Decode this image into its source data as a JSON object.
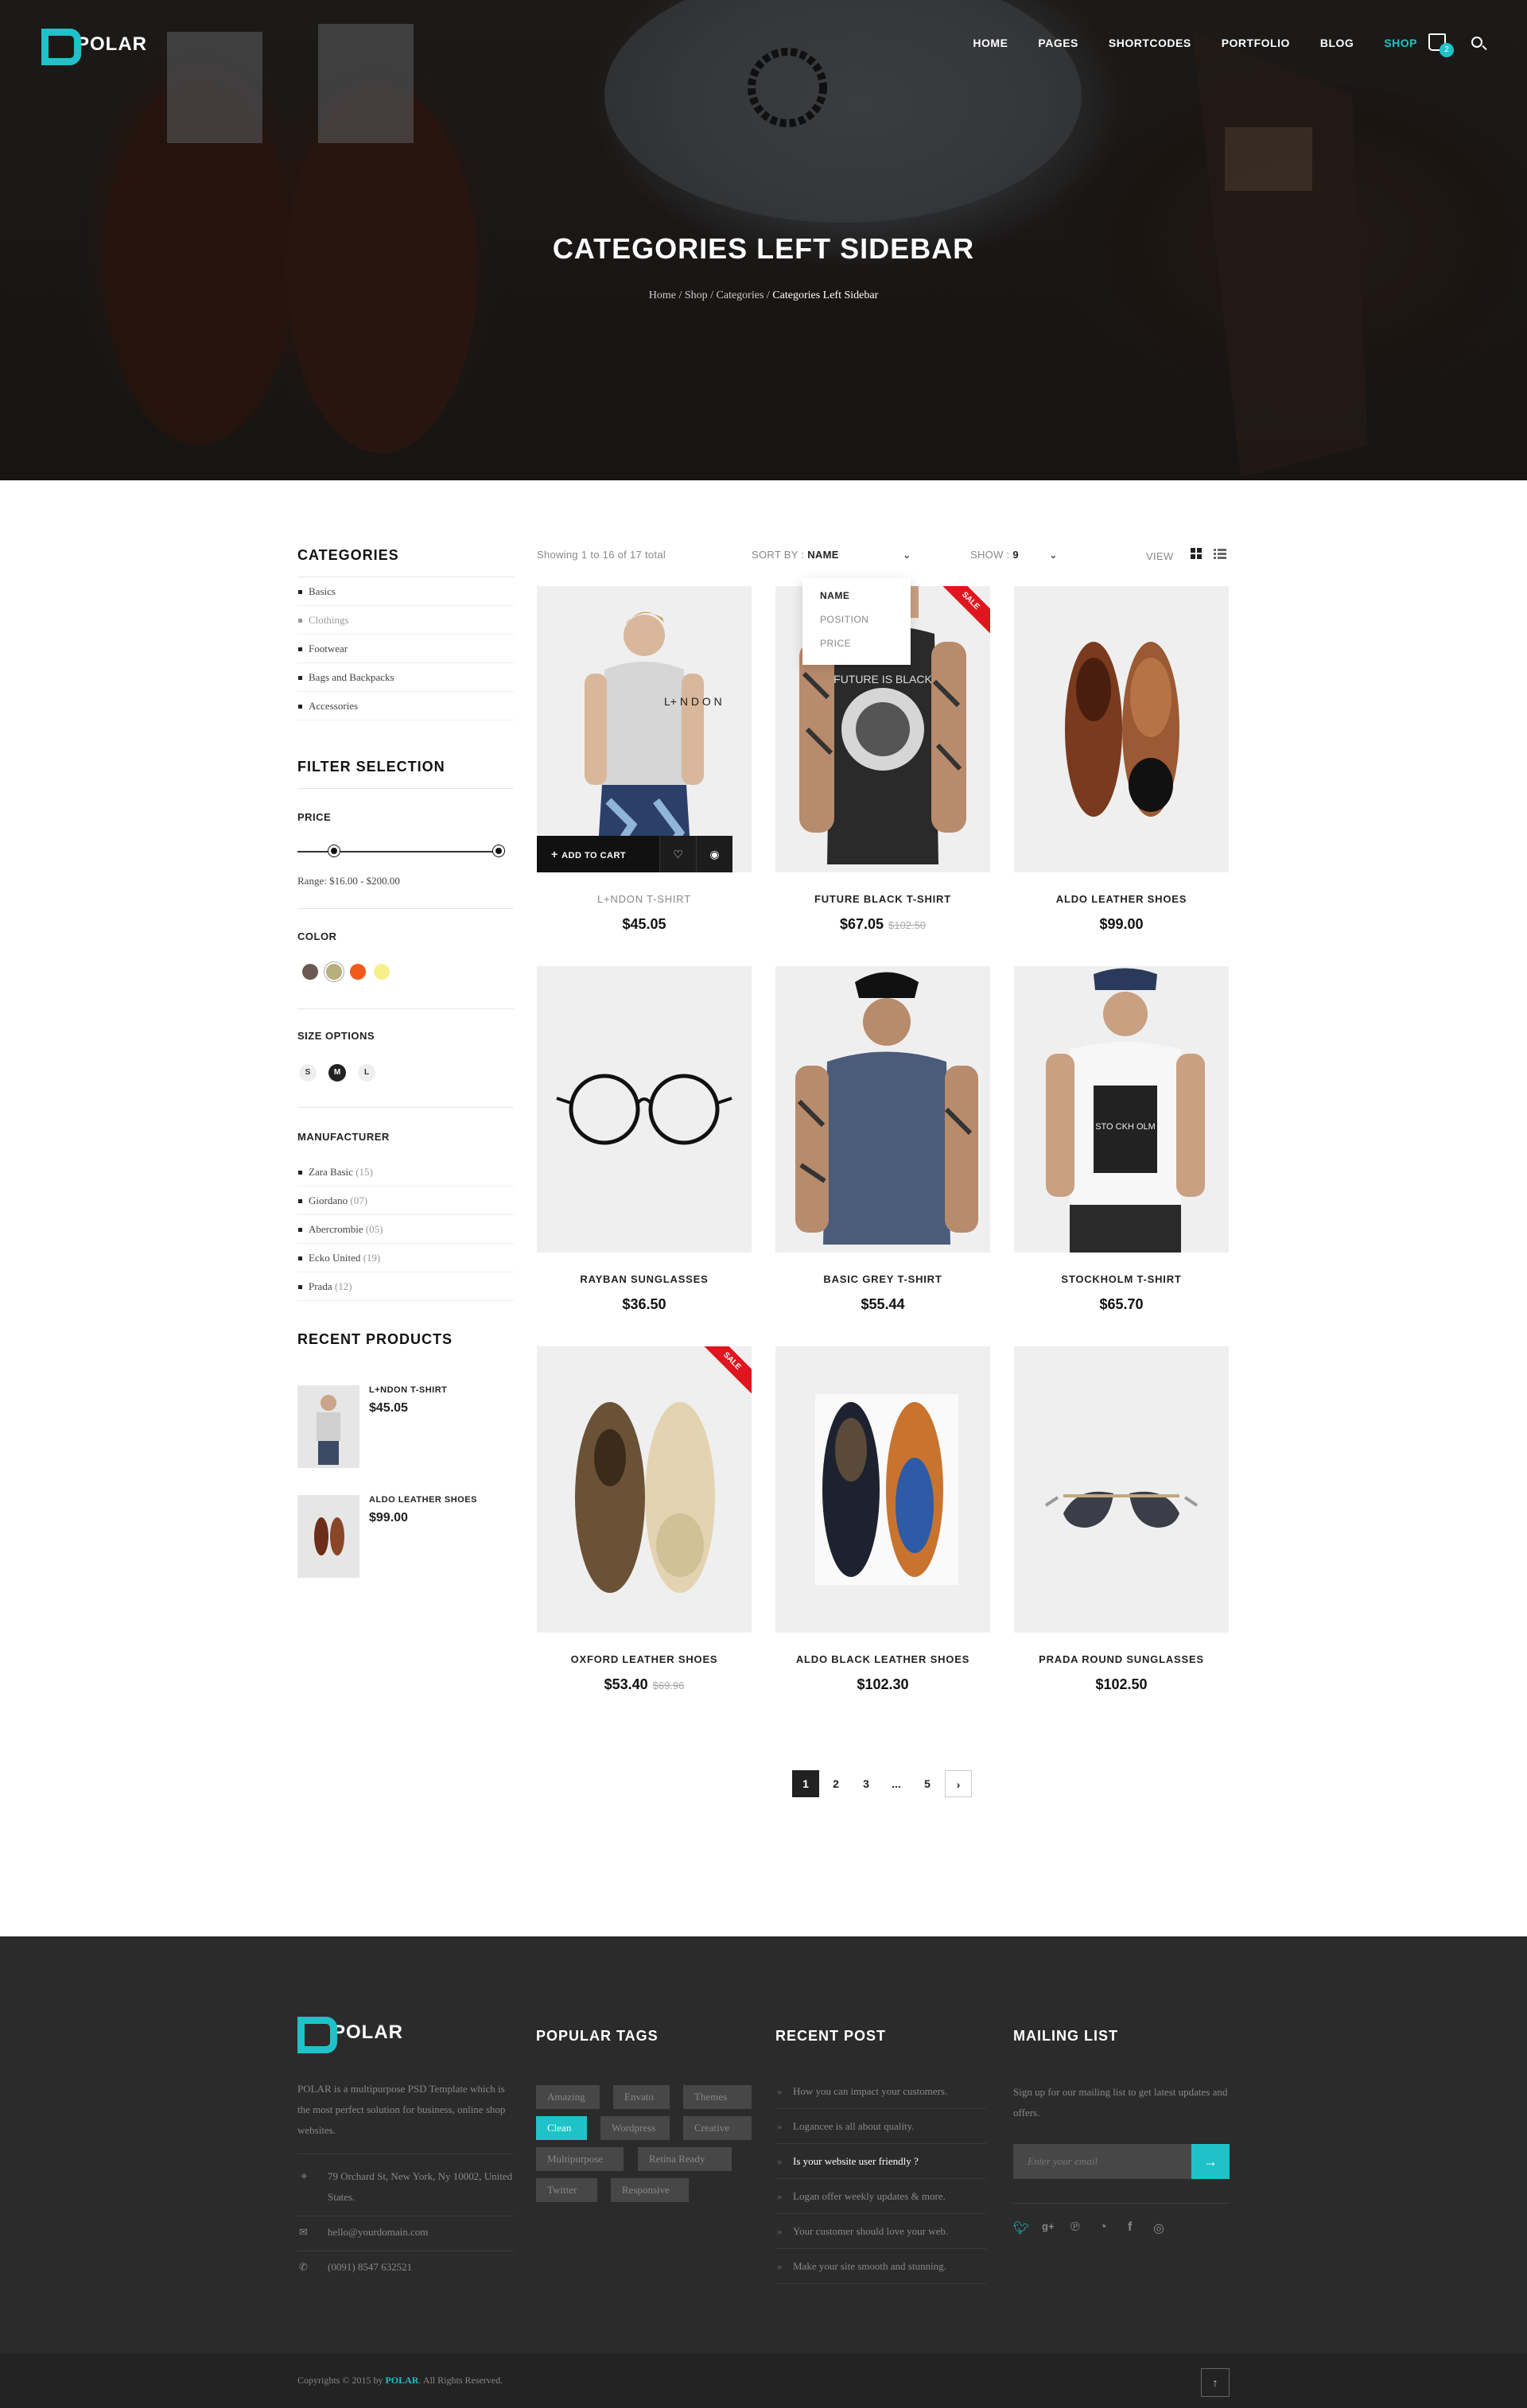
{
  "brand": {
    "name": "POLAR",
    "accent": "#1fc2c8"
  },
  "nav": {
    "items": [
      "HOME",
      "PAGES",
      "SHORTCODES",
      "PORTFOLIO",
      "BLOG",
      "SHOP"
    ],
    "active": "SHOP",
    "cart_count": "2"
  },
  "hero": {
    "title": "CATEGORIES LEFT SIDEBAR",
    "crumbs": [
      "Home",
      "Shop",
      "Categories",
      "Categories Left Sidebar"
    ],
    "sep": " / "
  },
  "sidebar": {
    "categories_title": "CATEGORIES",
    "categories": [
      "Basics",
      "Clothings",
      "Footwear",
      "Bags and Backpacks",
      "Accessories"
    ],
    "filter_title": "FILTER SELECTION",
    "price_label": "PRICE",
    "range_text": "Range: $16.00  -  $200.00",
    "color_label": "COLOR",
    "colors": [
      "#6b5a52",
      "#b5b07a",
      "#f05a1a",
      "#f6f08a"
    ],
    "size_label": "SIZE OPTIONS",
    "sizes": [
      "S",
      "M",
      "L"
    ],
    "size_selected": "M",
    "manufacturer_label": "MANUFACTURER",
    "manufacturers": [
      {
        "name": "Zara Basic",
        "count": "(15)"
      },
      {
        "name": "Giordano",
        "count": "(07)"
      },
      {
        "name": "Abercrombie",
        "count": "(05)"
      },
      {
        "name": "Ecko United",
        "count": "(19)"
      },
      {
        "name": "Prada",
        "count": "(12)"
      }
    ],
    "recent_title": "RECENT PRODUCTS",
    "recent": [
      {
        "name": "L+NDON T-SHIRT",
        "price": "$45.05"
      },
      {
        "name": "ALDO LEATHER SHOES",
        "price": "$99.00"
      }
    ]
  },
  "toolbar": {
    "showing": "Showing 1 to 16 of 17 total",
    "sort_label": "SORT BY :",
    "sort_value": "NAME",
    "sort_options": [
      "NAME",
      "POSITION",
      "PRICE"
    ],
    "show_label": "SHOW :",
    "show_value": "9",
    "view_label": "VIEW"
  },
  "products": [
    {
      "name": "L+NDON T-SHIRT",
      "price": "$45.05",
      "old": "",
      "sale": false
    },
    {
      "name": "FUTURE BLACK T-SHIRT",
      "price": "$67.05",
      "old": "$102.50",
      "sale": true
    },
    {
      "name": "ALDO LEATHER SHOES",
      "price": "$99.00",
      "old": "",
      "sale": false
    },
    {
      "name": "RAYBAN SUNGLASSES",
      "price": "$36.50",
      "old": "",
      "sale": false
    },
    {
      "name": "BASIC GREY T-SHIRT",
      "price": "$55.44",
      "old": "",
      "sale": false
    },
    {
      "name": "STOCKHOLM T-SHIRT",
      "price": "$65.70",
      "old": "",
      "sale": false
    },
    {
      "name": "OXFORD LEATHER SHOES",
      "price": "$53.40",
      "old": "$69.96",
      "sale": true
    },
    {
      "name": "ALDO BLACK LEATHER SHOES",
      "price": "$102.30",
      "old": "",
      "sale": false
    },
    {
      "name": "PRADA ROUND SUNGLASSES",
      "price": "$102.50",
      "old": "",
      "sale": false
    }
  ],
  "product_overlay": {
    "add": "ADD TO CART"
  },
  "sale_label": "SALE",
  "shirt_prints": {
    "london": "L+ N D O N",
    "future": "FUTURE IS BLACK",
    "stockholm": "STO CKH OLM"
  },
  "pagination": [
    "1",
    "2",
    "3",
    "...",
    "5"
  ],
  "footer": {
    "about": "POLAR is a multipurpose PSD Template which is the most perfect solution for business, online shop websites.",
    "address": "79 Orchard St, New York, Ny 10002, United States.",
    "email": "hello@yourdomain.com",
    "phone": "(0091) 8547 632521",
    "tags_title": "POPULAR TAGS",
    "tags": [
      "Amazing",
      "Envato",
      "Themes",
      "Clean",
      "Wordpress",
      "Creative",
      "Multipurpose",
      "Retina Ready",
      "Twitter",
      "Responsive"
    ],
    "posts_title": "RECENT POST",
    "posts": [
      "How you can impact your customers.",
      "Logancee is all about quality.",
      "Is your website user friendly ?",
      "Logan offer weekly updates & more.",
      "Your customer should love your web.",
      "Make your site smooth and stunning."
    ],
    "mail_title": "MAILING LIST",
    "mail_text": "Sign up for our mailing list to get latest updates and offers.",
    "mail_placeholder": "Enter your email",
    "copyright_pre": "Copyrights © 2015 by ",
    "copyright_brand": "POLAR",
    "copyright_post": ". All Rights Reserved."
  }
}
